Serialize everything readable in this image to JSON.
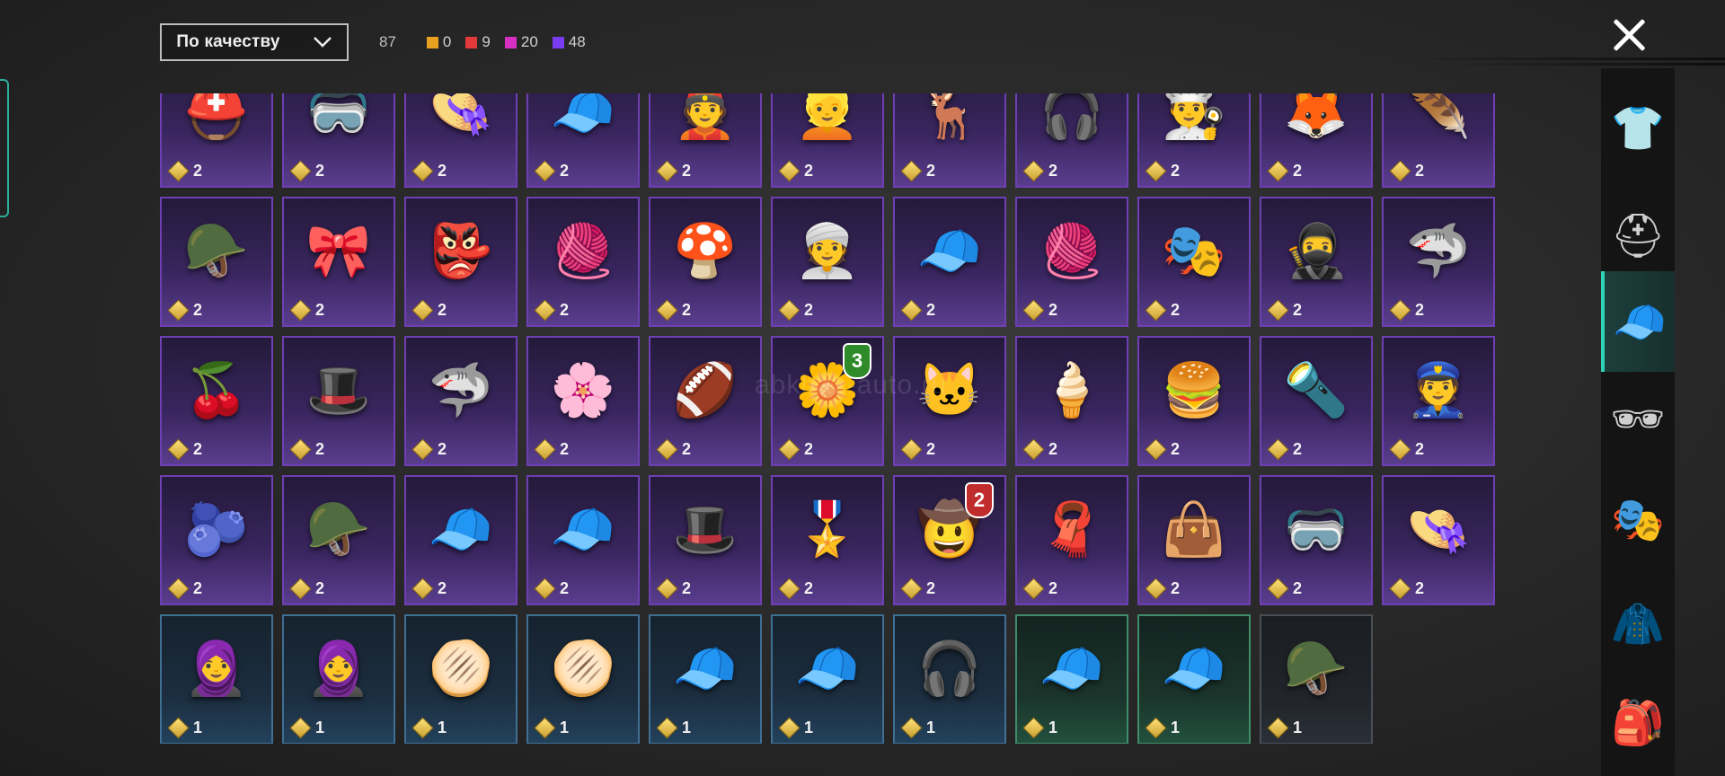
{
  "sort": {
    "label": "По качеству"
  },
  "counts": {
    "total": "87",
    "qualities": [
      {
        "color": "#e8a020",
        "value": "0"
      },
      {
        "color": "#e23a3a",
        "value": "9"
      },
      {
        "color": "#d62fc2",
        "value": "20"
      },
      {
        "color": "#7a3cf0",
        "value": "48"
      }
    ]
  },
  "watermark": "abkhaz-auto.ru",
  "items": [
    {
      "icon": "⛑️",
      "count": "2",
      "rarity": "purple"
    },
    {
      "icon": "🥽",
      "count": "2",
      "rarity": "purple"
    },
    {
      "icon": "👒",
      "count": "2",
      "rarity": "purple"
    },
    {
      "icon": "🧢",
      "count": "2",
      "rarity": "purple"
    },
    {
      "icon": "👲",
      "count": "2",
      "rarity": "purple"
    },
    {
      "icon": "👱",
      "count": "2",
      "rarity": "purple"
    },
    {
      "icon": "🦌",
      "count": "2",
      "rarity": "purple"
    },
    {
      "icon": "🎧",
      "count": "2",
      "rarity": "purple"
    },
    {
      "icon": "👨‍🍳",
      "count": "2",
      "rarity": "purple"
    },
    {
      "icon": "🦊",
      "count": "2",
      "rarity": "purple"
    },
    {
      "icon": "🪶",
      "count": "2",
      "rarity": "purple"
    },
    {
      "icon": "🪖",
      "count": "2",
      "rarity": "purple"
    },
    {
      "icon": "🎀",
      "count": "2",
      "rarity": "purple"
    },
    {
      "icon": "👺",
      "count": "2",
      "rarity": "purple"
    },
    {
      "icon": "🧶",
      "count": "2",
      "rarity": "purple"
    },
    {
      "icon": "🍄",
      "count": "2",
      "rarity": "purple"
    },
    {
      "icon": "👳",
      "count": "2",
      "rarity": "purple"
    },
    {
      "icon": "🧢",
      "count": "2",
      "rarity": "purple"
    },
    {
      "icon": "🧶",
      "count": "2",
      "rarity": "purple"
    },
    {
      "icon": "🎭",
      "count": "2",
      "rarity": "purple"
    },
    {
      "icon": "🥷",
      "count": "2",
      "rarity": "purple"
    },
    {
      "icon": "🦈",
      "count": "2",
      "rarity": "purple"
    },
    {
      "icon": "🍒",
      "count": "2",
      "rarity": "purple"
    },
    {
      "icon": "🎩",
      "count": "2",
      "rarity": "purple"
    },
    {
      "icon": "🦈",
      "count": "2",
      "rarity": "purple"
    },
    {
      "icon": "🌸",
      "count": "2",
      "rarity": "purple"
    },
    {
      "icon": "🏈",
      "count": "2",
      "rarity": "purple"
    },
    {
      "icon": "🌼",
      "count": "2",
      "rarity": "purple",
      "badge": {
        "text": "3",
        "color": "green"
      }
    },
    {
      "icon": "🐱",
      "count": "2",
      "rarity": "purple"
    },
    {
      "icon": "🍦",
      "count": "2",
      "rarity": "purple"
    },
    {
      "icon": "🍔",
      "count": "2",
      "rarity": "purple"
    },
    {
      "icon": "🔦",
      "count": "2",
      "rarity": "purple"
    },
    {
      "icon": "👮",
      "count": "2",
      "rarity": "purple"
    },
    {
      "icon": "🫐",
      "count": "2",
      "rarity": "purple"
    },
    {
      "icon": "🪖",
      "count": "2",
      "rarity": "purple"
    },
    {
      "icon": "🧢",
      "count": "2",
      "rarity": "purple"
    },
    {
      "icon": "🧢",
      "count": "2",
      "rarity": "purple"
    },
    {
      "icon": "🎩",
      "count": "2",
      "rarity": "purple"
    },
    {
      "icon": "🎖️",
      "count": "2",
      "rarity": "purple"
    },
    {
      "icon": "🤠",
      "count": "2",
      "rarity": "purple",
      "badge": {
        "text": "2",
        "color": "red"
      }
    },
    {
      "icon": "🧣",
      "count": "2",
      "rarity": "purple"
    },
    {
      "icon": "👜",
      "count": "2",
      "rarity": "purple"
    },
    {
      "icon": "🥽",
      "count": "2",
      "rarity": "purple"
    },
    {
      "icon": "👒",
      "count": "2",
      "rarity": "purple"
    },
    {
      "icon": "🧕",
      "count": "1",
      "rarity": "blue"
    },
    {
      "icon": "🧕",
      "count": "1",
      "rarity": "blue"
    },
    {
      "icon": "🫓",
      "count": "1",
      "rarity": "blue"
    },
    {
      "icon": "🫓",
      "count": "1",
      "rarity": "blue"
    },
    {
      "icon": "🧢",
      "count": "1",
      "rarity": "blue"
    },
    {
      "icon": "🧢",
      "count": "1",
      "rarity": "blue"
    },
    {
      "icon": "🎧",
      "count": "1",
      "rarity": "blue"
    },
    {
      "icon": "🧢",
      "count": "1",
      "rarity": "green"
    },
    {
      "icon": "🧢",
      "count": "1",
      "rarity": "green"
    },
    {
      "icon": "🪖",
      "count": "1",
      "rarity": "gray"
    }
  ],
  "sidebar": [
    {
      "name": "outfit",
      "glyph": "👕",
      "active": false
    },
    {
      "name": "helmet",
      "glyph": "⛑",
      "active": false
    },
    {
      "name": "hat",
      "glyph": "🧢",
      "active": true
    },
    {
      "name": "glasses",
      "glyph": "🕶",
      "active": false
    },
    {
      "name": "mask",
      "glyph": "🎭",
      "active": false
    },
    {
      "name": "jacket",
      "glyph": "🧥",
      "active": false
    },
    {
      "name": "backpack",
      "glyph": "🎒",
      "active": false
    }
  ]
}
